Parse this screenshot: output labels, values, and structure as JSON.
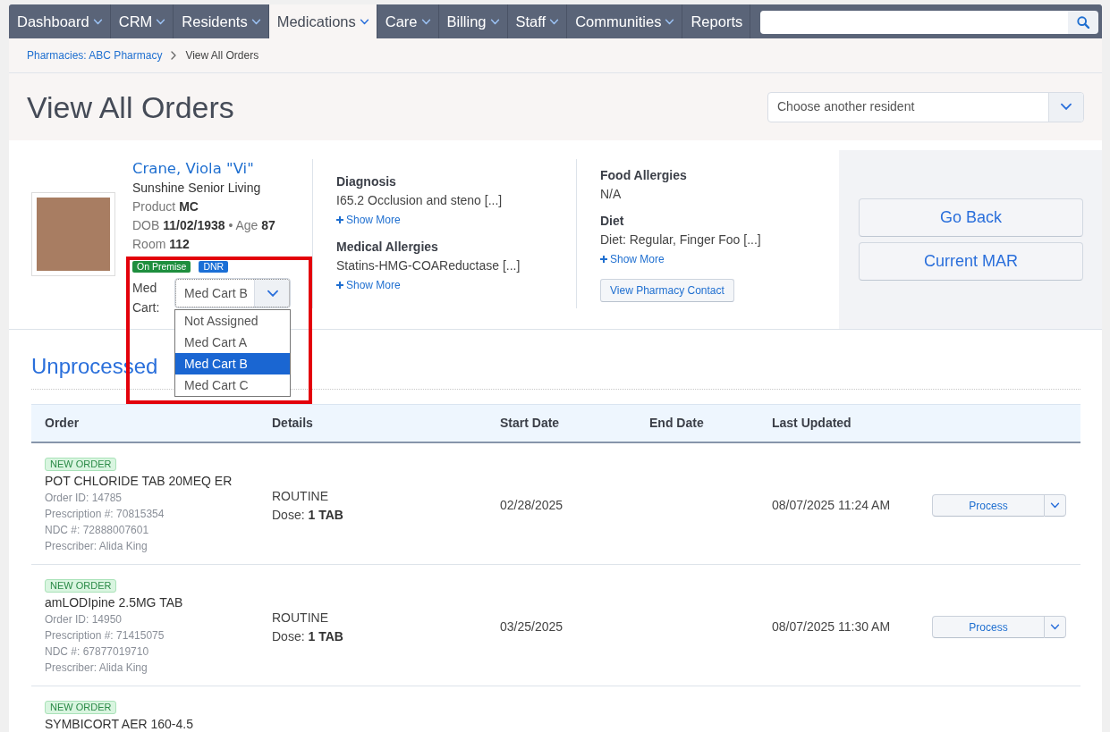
{
  "nav": {
    "items": [
      {
        "label": "Dashboard",
        "dropdown": true,
        "selected": false
      },
      {
        "label": "CRM",
        "dropdown": true,
        "selected": false
      },
      {
        "label": "Residents",
        "dropdown": true,
        "selected": false
      },
      {
        "label": "Medications",
        "dropdown": true,
        "selected": true
      },
      {
        "label": "Care",
        "dropdown": true,
        "selected": false
      },
      {
        "label": "Billing",
        "dropdown": true,
        "selected": false
      },
      {
        "label": "Staff",
        "dropdown": true,
        "selected": false
      },
      {
        "label": "Communities",
        "dropdown": true,
        "selected": false
      },
      {
        "label": "Reports",
        "dropdown": false,
        "selected": false
      }
    ]
  },
  "breadcrumb": [
    {
      "label": "Pharmacies: ABC Pharmacy",
      "kind": "link"
    },
    {
      "label": "View All Orders",
      "kind": "current"
    }
  ],
  "page_title": "View All Orders",
  "resident_picker": {
    "placeholder": "Choose another resident"
  },
  "resident": {
    "name": "Crane, Viola \"Vi\"",
    "community": "Sunshine Senior Living",
    "info_lines": [
      "Product **MC**",
      "DOB **11/02/1938** • Age **87**",
      "Room **112**"
    ],
    "badges": [
      {
        "label": "On Premise",
        "color": "#1e8e3e"
      },
      {
        "label": "DNR",
        "color": "#1b6fd6"
      }
    ],
    "med_cart": {
      "label": "Med Cart:",
      "value": "Med Cart B",
      "expanded": true,
      "options": [
        {
          "label": "Not Assigned",
          "selected": false
        },
        {
          "label": "Med Cart A",
          "selected": false
        },
        {
          "label": "Med Cart B",
          "selected": true
        },
        {
          "label": "Med Cart C",
          "selected": false
        }
      ]
    }
  },
  "clinical_columns": [
    [
      {
        "heading": "Diagnosis",
        "text": "I65.2 Occlusion and steno [...]",
        "more": "Show More"
      },
      {
        "heading": "Medical Allergies",
        "text": "Statins-HMG-COAReductase [...]",
        "more": "Show More"
      }
    ],
    [
      {
        "heading": "Food Allergies",
        "text": "N/A"
      },
      {
        "heading": "Diet",
        "text": "Diet: Regular, Finger Foo [...]",
        "more": "Show More"
      }
    ]
  ],
  "pharmacy_contact_button": "View Pharmacy Contact",
  "action_buttons": [
    "Go Back",
    "Current MAR"
  ],
  "section_title": "Unprocessed",
  "table": {
    "columns": [
      "Order",
      "Details",
      "Start Date",
      "End Date",
      "Last Updated"
    ],
    "rows": [
      {
        "status": "NEW ORDER",
        "medication": "POT CHLORIDE TAB 20MEQ ER",
        "meta": [
          "Order ID: 14785",
          "Prescription #: 70815354",
          "NDC #: 72888007601",
          "Prescriber: Alida King"
        ],
        "priority": "ROUTINE",
        "dose": "Dose: **1 TAB**",
        "start_date": "02/28/2025",
        "last_updated": "08/07/2025 11:24 AM",
        "action": "Process"
      },
      {
        "status": "NEW ORDER",
        "medication": "amLODIpine 2.5MG TAB",
        "meta": [
          "Order ID: 14950",
          "Prescription #: 71415075",
          "NDC #: 67877019710",
          "Prescriber: Alida King"
        ],
        "priority": "ROUTINE",
        "dose": "Dose: **1 TAB**",
        "start_date": "03/25/2025",
        "last_updated": "08/07/2025 11:30 AM",
        "action": "Process"
      },
      {
        "status": "NEW ORDER",
        "medication": "SYMBICORT AER 160-4.5"
      }
    ]
  }
}
